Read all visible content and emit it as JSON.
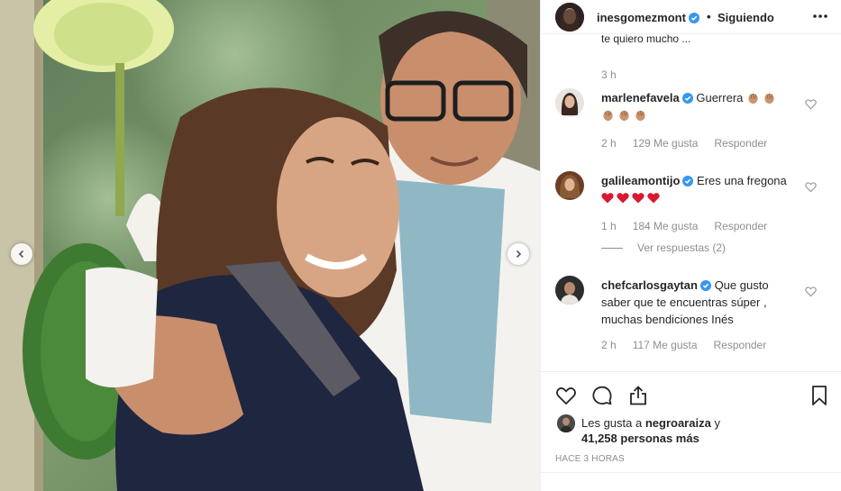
{
  "post": {
    "author": "inesgomezmont",
    "follow_status": "Siguiendo",
    "header_dot": "•",
    "photo_alt": "Photo"
  },
  "comments": {
    "cut_text": "te quiero mucho ... ",
    "first_time": "3 h",
    "items": [
      {
        "user": "marlenefavela",
        "text": "Guerrera",
        "emojis": "clap-hands x5",
        "time": "2 h",
        "likes": "129 Me gusta",
        "reply": "Responder"
      },
      {
        "user": "galileamontijo",
        "text": "Eres una fregona",
        "emojis": "red-heart x4",
        "time": "1 h",
        "likes": "184 Me gusta",
        "reply": "Responder",
        "view_replies": "Ver respuestas (2)"
      },
      {
        "user": "chefcarlosgaytan",
        "text": "Que gusto saber que te encuentras súper , muchas bendiciones Inés",
        "time": "2 h",
        "likes": "117 Me gusta",
        "reply": "Responder"
      }
    ]
  },
  "likes": {
    "prefix": "Les gusta a",
    "user": "negroaraiza",
    "suffix": "y",
    "count": "41,258 personas más"
  },
  "timestamp": "HACE 3 HORAS",
  "colors": {
    "verified": "#3897f0",
    "text": "#262626",
    "muted": "#8e8e8e",
    "heart": "#d8192f",
    "border": "#efefef"
  },
  "icons": [
    "verified-badge-icon",
    "more-options-icon",
    "heart-icon",
    "comment-icon",
    "share-icon",
    "bookmark-icon",
    "chevron-left-icon",
    "chevron-right-icon"
  ]
}
